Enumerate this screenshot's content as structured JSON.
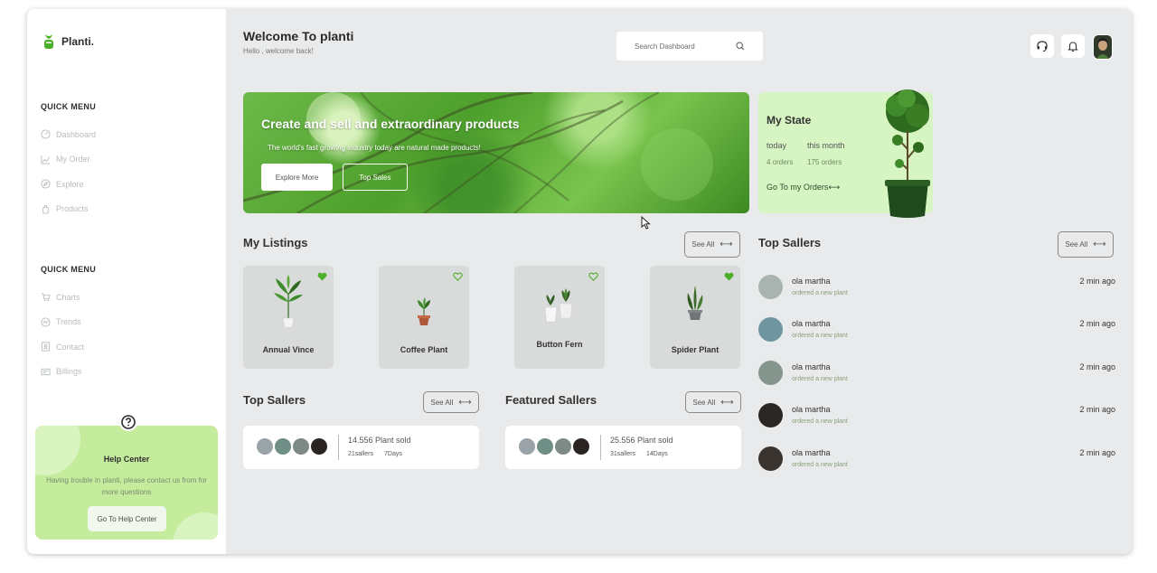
{
  "brand": {
    "name": "Planti."
  },
  "sidebar": {
    "menu1_title": "QUICK MENU",
    "menu1": [
      {
        "label": "Dashboard",
        "icon": "dashboard-icon"
      },
      {
        "label": "My Order",
        "icon": "chart-line-icon"
      },
      {
        "label": "Explore",
        "icon": "compass-icon"
      },
      {
        "label": "Products",
        "icon": "hand-icon"
      }
    ],
    "menu2_title": "QUICK MENU",
    "menu2": [
      {
        "label": "Charts",
        "icon": "cart-icon"
      },
      {
        "label": "Trends",
        "icon": "trend-icon"
      },
      {
        "label": "Contact",
        "icon": "contact-icon"
      },
      {
        "label": "Billings",
        "icon": "billing-icon"
      }
    ],
    "help": {
      "title": "Help Center",
      "text": "Having trouble in planti, please contact us from for more questions",
      "button": "Go To Help Center"
    }
  },
  "header": {
    "title": "Welcome To planti",
    "subtitle": "Hello , welcome back!",
    "search_placeholder": "Search Dashboard"
  },
  "hero": {
    "title": "Create and sell and extraordinary products",
    "subtitle": "The world's fast growing industry today are natural made products!",
    "button_primary": "Explore More",
    "button_secondary": "Top Sales"
  },
  "state": {
    "title": "My State",
    "today_label": "today",
    "month_label": "this month",
    "today_value": "4 orders",
    "month_value": "175 orders",
    "link": "Go To my Orders⟷"
  },
  "listings": {
    "title": "My Listings",
    "see_all": "See All",
    "items": [
      {
        "name": "Annual Vince"
      },
      {
        "name": "Coffee Plant"
      },
      {
        "name": "Button Fern"
      },
      {
        "name": "Spider Plant"
      }
    ]
  },
  "top_sellers_small": {
    "title": "Top Sallers",
    "see_all": "See All",
    "main": "14.556 Plant sold",
    "sub1": "21sallers",
    "sub2": "7Days"
  },
  "featured_sellers": {
    "title": "Featured Sallers",
    "see_all": "See All",
    "main": "25.556 Plant sold",
    "sub1": "31sallers",
    "sub2": "14Days"
  },
  "top_sellers": {
    "title": "Top Sallers",
    "see_all": "See All",
    "items": [
      {
        "name": "ola martha",
        "action": "ordered a new plant",
        "time": "2 min ago"
      },
      {
        "name": "ola martha",
        "action": "ordered a new plant",
        "time": "2 min ago"
      },
      {
        "name": "ola martha",
        "action": "ordered a new plant",
        "time": "2 min ago"
      },
      {
        "name": "ola martha",
        "action": "ordered a new plant",
        "time": "2 min ago"
      },
      {
        "name": "ola martha",
        "action": "ordered a new plant",
        "time": "2 min ago"
      }
    ]
  },
  "colors": {
    "accent": "#4caf2a",
    "panel_green": "#d6f5c3",
    "help_green": "#c5ec9d"
  }
}
